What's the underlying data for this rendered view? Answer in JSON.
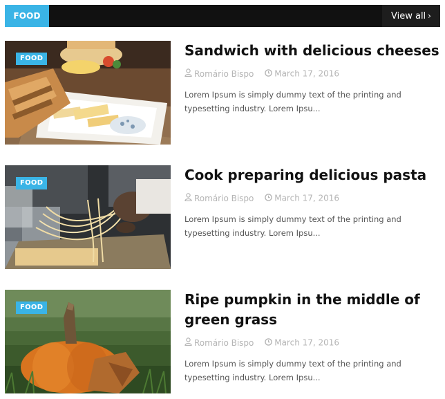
{
  "header": {
    "category": "FOOD",
    "view_all": "View all"
  },
  "posts": [
    {
      "badge": "FOOD",
      "title": "Sandwich with delicious cheeses",
      "author": "Romário Bispo",
      "date": "March 17, 2016",
      "excerpt": "Lorem Ipsum is simply dummy text of the printing and typesetting industry. Lorem Ipsu..."
    },
    {
      "badge": "FOOD",
      "title": "Cook preparing delicious pasta",
      "author": "Romário Bispo",
      "date": "March 17, 2016",
      "excerpt": "Lorem Ipsum is simply dummy text of the printing and typesetting industry. Lorem Ipsu..."
    },
    {
      "badge": "FOOD",
      "title": "Ripe pumpkin in the middle of green grass",
      "author": "Romário Bispo",
      "date": "March 17, 2016",
      "excerpt": "Lorem Ipsum is simply dummy text of the printing and typesetting industry. Lorem Ipsu..."
    }
  ],
  "colors": {
    "accent": "#3ab4e6",
    "header_bg": "#111111",
    "meta": "#b5b5b5"
  },
  "icons": {
    "author": "user-icon",
    "date": "clock-icon",
    "view_all": "chevron-right-icon"
  }
}
